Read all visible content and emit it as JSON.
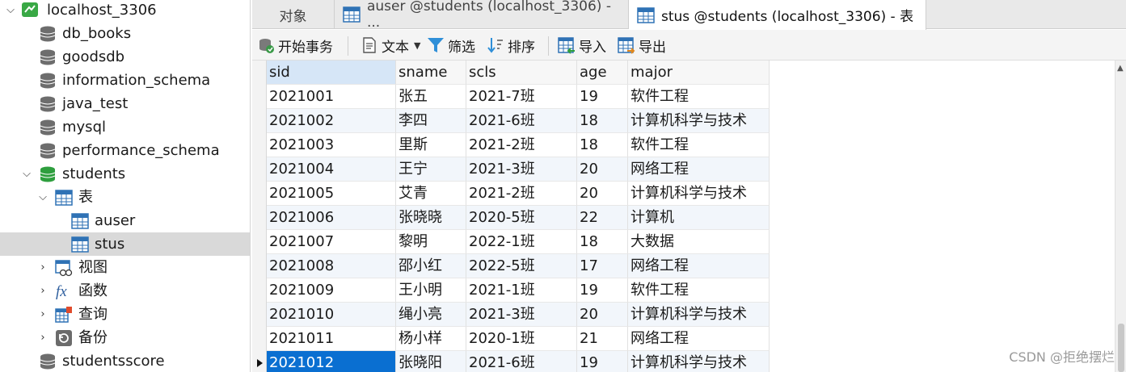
{
  "navigator": {
    "connection": "localhost_3306",
    "databases": [
      "db_books",
      "goodsdb",
      "information_schema",
      "java_test",
      "mysql",
      "performance_schema",
      "students"
    ],
    "open_db_children": {
      "tables_group": "表",
      "tables": [
        "auser",
        "stus"
      ],
      "views": "视图",
      "functions": "函数",
      "queries": "查询",
      "backups": "备份"
    },
    "after": [
      "studentsscore"
    ]
  },
  "tabs": [
    {
      "label": "对象"
    },
    {
      "label": "auser @students (localhost_3306) - ..."
    },
    {
      "label": "stus @students (localhost_3306) - 表"
    }
  ],
  "toolbar": {
    "begin_tx": "开始事务",
    "text": "文本",
    "filter": "筛选",
    "sort": "排序",
    "import": "导入",
    "export": "导出"
  },
  "grid": {
    "columns": [
      "sid",
      "sname",
      "scls",
      "age",
      "major"
    ],
    "rows": [
      [
        "2021001",
        "张五",
        "2021-7班",
        "19",
        "软件工程"
      ],
      [
        "2021002",
        "李四",
        "2021-6班",
        "18",
        "计算机科学与技术"
      ],
      [
        "2021003",
        "里斯",
        "2021-2班",
        "18",
        "软件工程"
      ],
      [
        "2021004",
        "王宁",
        "2021-3班",
        "20",
        "网络工程"
      ],
      [
        "2021005",
        "艾青",
        "2021-2班",
        "20",
        "计算机科学与技术"
      ],
      [
        "2021006",
        "张晓晓",
        "2020-5班",
        "22",
        "计算机"
      ],
      [
        "2021007",
        "黎明",
        "2022-1班",
        "18",
        "大数据"
      ],
      [
        "2021008",
        "邵小红",
        "2022-5班",
        "17",
        "网络工程"
      ],
      [
        "2021009",
        "王小明",
        "2021-1班",
        "19",
        "软件工程"
      ],
      [
        "2021010",
        "绳小亮",
        "2021-3班",
        "20",
        "计算机科学与技术"
      ],
      [
        "2021011",
        "杨小样",
        "2020-1班",
        "21",
        "网络工程"
      ],
      [
        "2021012",
        "张晓阳",
        "2021-6班",
        "19",
        "计算机科学与技术"
      ]
    ]
  },
  "watermark": "CSDN @拒绝摆烂",
  "colors": {
    "selection": "#0a6fd1",
    "tree_selected": "#d9d9d9",
    "db_icon": "#6d6d6d",
    "db_icon_open": "#2e9e3e"
  }
}
